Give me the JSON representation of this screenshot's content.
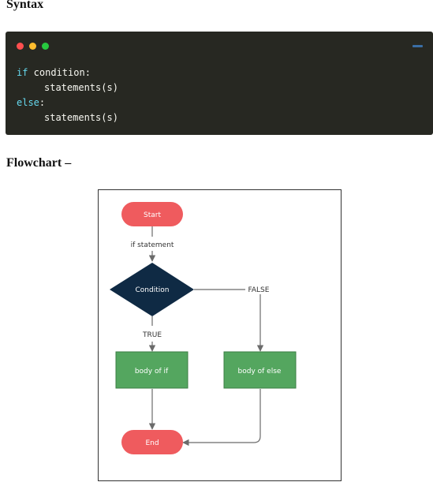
{
  "syntax_heading": "Syntax",
  "code": {
    "window_dots": [
      "red",
      "yellow",
      "green"
    ],
    "line1_keyword": "if",
    "line1_rest": " condition:",
    "line2": "statements(s)",
    "line3_keyword": "else",
    "line3_rest": ":",
    "line4": "statements(s)"
  },
  "flowchart_heading": "Flowchart –",
  "flowchart": {
    "start": "Start",
    "if_statement": "if statement",
    "condition": "Condition",
    "false_label": "FALSE",
    "true_label": "TRUE",
    "body_if": "body of if",
    "body_else": "body of else",
    "end": "End"
  },
  "colors": {
    "code_bg": "#272822",
    "keyword": "#66d9ef",
    "terminal": "#ef5b5e",
    "decision": "#0f2a44",
    "process": "#54a65f"
  }
}
